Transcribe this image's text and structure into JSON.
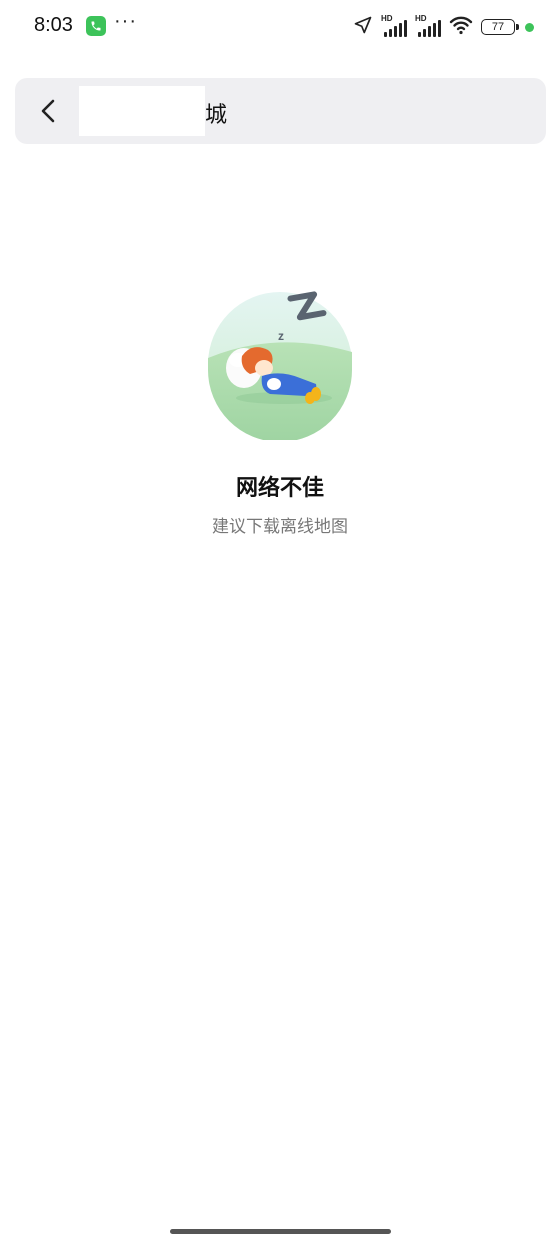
{
  "status_bar": {
    "time": "8:03",
    "more_indicator": "···",
    "signal1_label": "HD",
    "signal2_label": "HD",
    "battery": "77",
    "icons": [
      "phone-call-icon",
      "location-arrow-icon",
      "signal-icon",
      "wifi-icon",
      "battery-icon"
    ]
  },
  "header": {
    "title_suffix": "城",
    "back_icon": "chevron-left-icon"
  },
  "empty_state": {
    "title": "网络不佳",
    "subtitle": "建议下载离线地图",
    "illustration": "sleeping-character-icon"
  },
  "colors": {
    "accent_green": "#3dc35a",
    "header_bg": "#efeff2",
    "subtitle_text": "#777777"
  }
}
